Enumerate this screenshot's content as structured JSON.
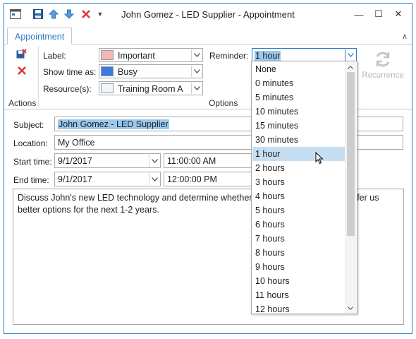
{
  "window": {
    "title": "John Gomez - LED Supplier - Appointment",
    "controls": {
      "minimize": "—",
      "maximize": "☐",
      "close": "✕"
    }
  },
  "tabs": {
    "appointment": "Appointment"
  },
  "ribbon": {
    "actions_group": "Actions",
    "options_group": "Options",
    "label_caption": "Label:",
    "label_value": "Important",
    "label_color": "#f4b6b6",
    "show_time_caption": "Show time as:",
    "show_time_value": "Busy",
    "show_time_color": "#3c7bde",
    "resources_caption": "Resource(s):",
    "resources_value": "Training Room A",
    "resources_color": "#eef6fa",
    "reminder_caption": "Reminder:",
    "reminder_value": "1 hour",
    "recurrence_label": "Recurrence"
  },
  "form": {
    "subject_label": "Subject:",
    "subject_value": "John Gomez - LED Supplier",
    "location_label": "Location:",
    "location_value": "My Office",
    "start_label": "Start time:",
    "start_date": "9/1/2017",
    "start_time": "11:00:00 AM",
    "end_label": "End time:",
    "end_date": "9/1/2017",
    "end_time": "12:00:00 PM",
    "notes_line1_a": "Discuss John's new LED technology and determine whether wo",
    "notes_line1_b": "offer us",
    "notes_line2": "better options for the next 1-2 years."
  },
  "reminder_dropdown": {
    "selected": "1 hour",
    "items": [
      "None",
      "0 minutes",
      "5 minutes",
      "10 minutes",
      "15 minutes",
      "30 minutes",
      "1 hour",
      "2 hours",
      "3 hours",
      "4 hours",
      "5 hours",
      "6 hours",
      "7 hours",
      "8 hours",
      "9 hours",
      "10 hours",
      "11 hours",
      "12 hours"
    ]
  },
  "colors": {
    "accent": "#2b78c5",
    "selection": "#99c9ef",
    "hover": "#c6def2"
  }
}
